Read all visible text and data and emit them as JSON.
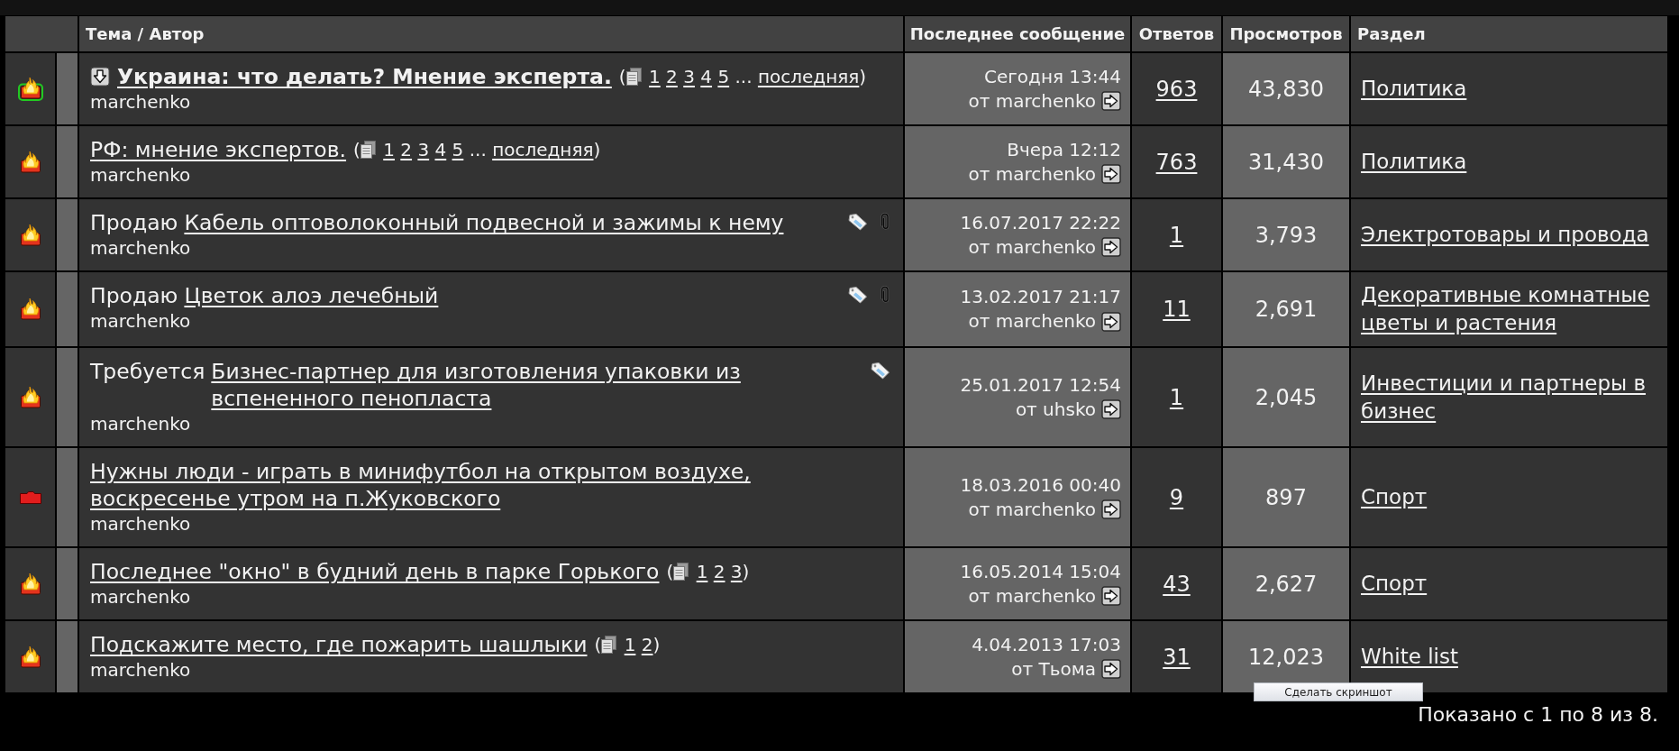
{
  "table": {
    "columns": [
      "Тема / Автор",
      "Последнее сообщение",
      "Ответов",
      "Просмотров",
      "Раздел"
    ],
    "rows": [
      {
        "status_icon": {
          "kind": "hot",
          "outlined": true
        },
        "title_icon": true,
        "title": "Украина: что делать? Мнение эксперта.",
        "bold": true,
        "pagination": {
          "open": "(",
          "pages": [
            "1",
            "2",
            "3",
            "4",
            "5"
          ],
          "ellipsis": "...",
          "last": "последняя",
          "close": ")"
        },
        "tag": false,
        "attachment": false,
        "author": "marchenko",
        "last_post": {
          "date": "Сегодня 13:44",
          "by": "от marchenko"
        },
        "replies": "963",
        "views": "43,830",
        "section": "Политика"
      },
      {
        "status_icon": {
          "kind": "hot",
          "outlined": false
        },
        "title_icon": false,
        "title": "РФ: мнение экспертов.",
        "bold": false,
        "pagination": {
          "open": "(",
          "pages": [
            "1",
            "2",
            "3",
            "4",
            "5"
          ],
          "ellipsis": "...",
          "last": "последняя",
          "close": ")"
        },
        "tag": false,
        "attachment": false,
        "author": "marchenko",
        "last_post": {
          "date": "Вчера 12:12",
          "by": "от marchenko"
        },
        "replies": "763",
        "views": "31,430",
        "section": "Политика"
      },
      {
        "status_icon": {
          "kind": "hot",
          "outlined": false
        },
        "title_icon": false,
        "prefix": "Продаю",
        "title": "Кабель оптоволоконный подвесной и зажимы к нему",
        "bold": false,
        "tag": true,
        "attachment": true,
        "author": "marchenko",
        "last_post": {
          "date": "16.07.2017 22:22",
          "by": "от marchenko"
        },
        "replies": "1",
        "views": "3,793",
        "section": "Электротовары и провода"
      },
      {
        "status_icon": {
          "kind": "hot",
          "outlined": false
        },
        "title_icon": false,
        "prefix": "Продаю",
        "title": "Цветок алоэ лечебный",
        "bold": false,
        "tag": true,
        "attachment": true,
        "author": "marchenko",
        "last_post": {
          "date": "13.02.2017 21:17",
          "by": "от marchenko"
        },
        "replies": "11",
        "views": "2,691",
        "section": "Декоративные комнатные цветы и растения"
      },
      {
        "status_icon": {
          "kind": "hot",
          "outlined": false
        },
        "title_icon": false,
        "prefix": "Требуется",
        "title": "Бизнес-партнер для изготовления упаковки из вспененного пенопласта",
        "bold": false,
        "tag": true,
        "attachment": false,
        "author": "marchenko",
        "last_post": {
          "date": "25.01.2017 12:54",
          "by": "от uhsko"
        },
        "replies": "1",
        "views": "2,045",
        "section": "Инвестиции и партнеры в бизнес"
      },
      {
        "status_icon": {
          "kind": "folder",
          "outlined": false
        },
        "title_icon": false,
        "title": "Нужны люди - играть в минифутбол на открытом воздухе, воскресенье утром на п.Жуковского",
        "bold": false,
        "tag": false,
        "attachment": false,
        "author": "marchenko",
        "last_post": {
          "date": "18.03.2016 00:40",
          "by": "от marchenko"
        },
        "replies": "9",
        "views": "897",
        "section": "Спорт"
      },
      {
        "status_icon": {
          "kind": "hot",
          "outlined": false
        },
        "title_icon": false,
        "title": "Последнее \"окно\" в будний день в парке Горького",
        "bold": false,
        "pagination": {
          "open": "(",
          "pages": [
            "1",
            "2",
            "3"
          ],
          "close": ")"
        },
        "tag": false,
        "attachment": false,
        "author": "marchenko",
        "last_post": {
          "date": "16.05.2014 15:04",
          "by": "от marchenko"
        },
        "replies": "43",
        "views": "2,627",
        "section": "Спорт"
      },
      {
        "status_icon": {
          "kind": "hot",
          "outlined": false
        },
        "title_icon": false,
        "title": "Подскажите место, где пожарить шашлыки",
        "bold": false,
        "pagination": {
          "open": "(",
          "pages": [
            "1",
            "2"
          ],
          "close": ")"
        },
        "tag": false,
        "attachment": false,
        "author": "marchenko",
        "last_post": {
          "date": "4.04.2013 17:03",
          "by": "от Тьома"
        },
        "replies": "31",
        "views": "12,023",
        "section": "White list"
      }
    ]
  },
  "footer": {
    "summary": "Показано с 1 по 8 из 8."
  },
  "screenshot_button": {
    "label": "Сделать скриншот"
  }
}
